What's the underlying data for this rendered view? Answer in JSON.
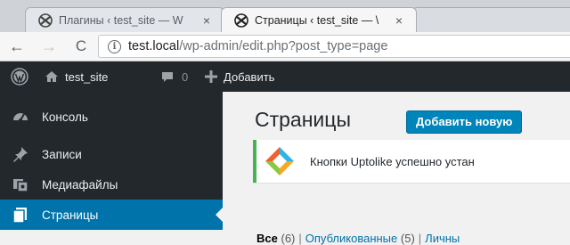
{
  "browser": {
    "tabs": [
      {
        "title": "Плагины ‹ test_site — W",
        "close": "×",
        "active": false
      },
      {
        "title": "Страницы ‹ test_site — \\",
        "close": "×",
        "active": true
      }
    ],
    "url_host": "test.local",
    "url_path": "/wp-admin/edit.php?post_type=page",
    "back": "←",
    "forward": "→",
    "reload": "C",
    "info": "i"
  },
  "adminbar": {
    "site_name": "test_site",
    "comments_count": "0",
    "new_label": "Добавить"
  },
  "sidebar": {
    "items": [
      {
        "label": "Консоль",
        "icon": "dashboard-icon"
      },
      {
        "label": "Записи",
        "icon": "pushpin-icon"
      },
      {
        "label": "Медиафайлы",
        "icon": "media-icon"
      },
      {
        "label": "Страницы",
        "icon": "pages-icon",
        "current": true
      }
    ]
  },
  "main": {
    "title": "Страницы",
    "add_new": "Добавить новую",
    "notice": "Кнопки Uptolike успешно устан",
    "filters": {
      "all": "Все",
      "all_count": "(6)",
      "published": "Опубликованные",
      "published_count": "(5)",
      "private": "Личны",
      "sep": "|"
    }
  },
  "colors": {
    "admin_dark": "#23282d",
    "accent_blue": "#0073aa",
    "button_blue": "#0085ba",
    "notice_green": "#46b450"
  }
}
